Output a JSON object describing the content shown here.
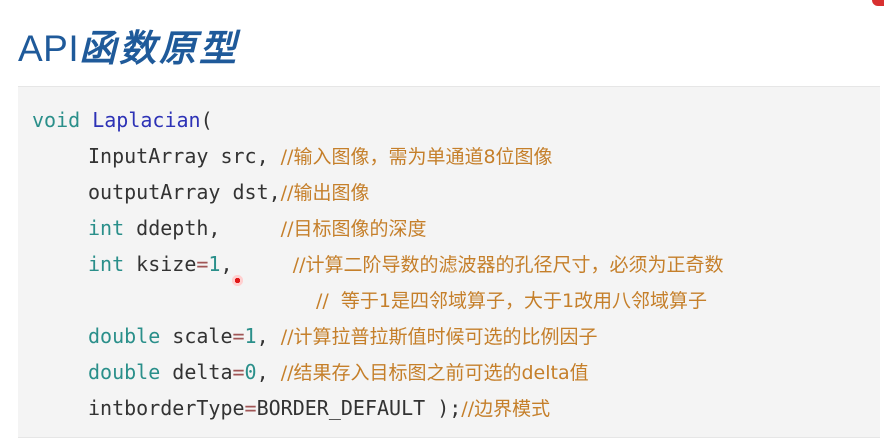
{
  "title": {
    "latin": "API",
    "chinese": "函数原型"
  },
  "code": {
    "l1": {
      "type": "void",
      "name": "Laplacian",
      "paren": "("
    },
    "l2": {
      "text": "InputArray src, ",
      "comment": "//输入图像，需为单通道8位图像"
    },
    "l3": {
      "text": "outputArray dst,",
      "comment": "//输出图像"
    },
    "l4": {
      "type": "int",
      "text": " ddepth,     ",
      "comment": "//目标图像的深度"
    },
    "l5": {
      "type": "int",
      "text": " ksize",
      "op": "=",
      "value": "1",
      "rest": ",     ",
      "comment": "//计算二阶导数的滤波器的孔径尺寸，必须为正奇数"
    },
    "l6": {
      "comment": "//  等于1是四邻域算子，大于1改用八邻域算子"
    },
    "l7": {
      "type": "double",
      "text": " scale",
      "op": "=",
      "value": "1",
      "rest": ", ",
      "comment": "//计算拉普拉斯值时候可选的比例因子"
    },
    "l8": {
      "type": "double",
      "text": " delta",
      "op": "=",
      "value": "0",
      "rest": ", ",
      "comment": "//结果存入目标图之前可选的delta值"
    },
    "l9": {
      "text": "intborderType",
      "op": "=",
      "value": "BORDER_DEFAULT",
      "rest": " );",
      "comment": "//边界模式"
    }
  },
  "colors": {
    "title": "#1f5a9a",
    "keyword": "#2a8f8a",
    "function": "#2d32b6",
    "comment": "#c57f2a",
    "background": "#f4f4f4"
  }
}
